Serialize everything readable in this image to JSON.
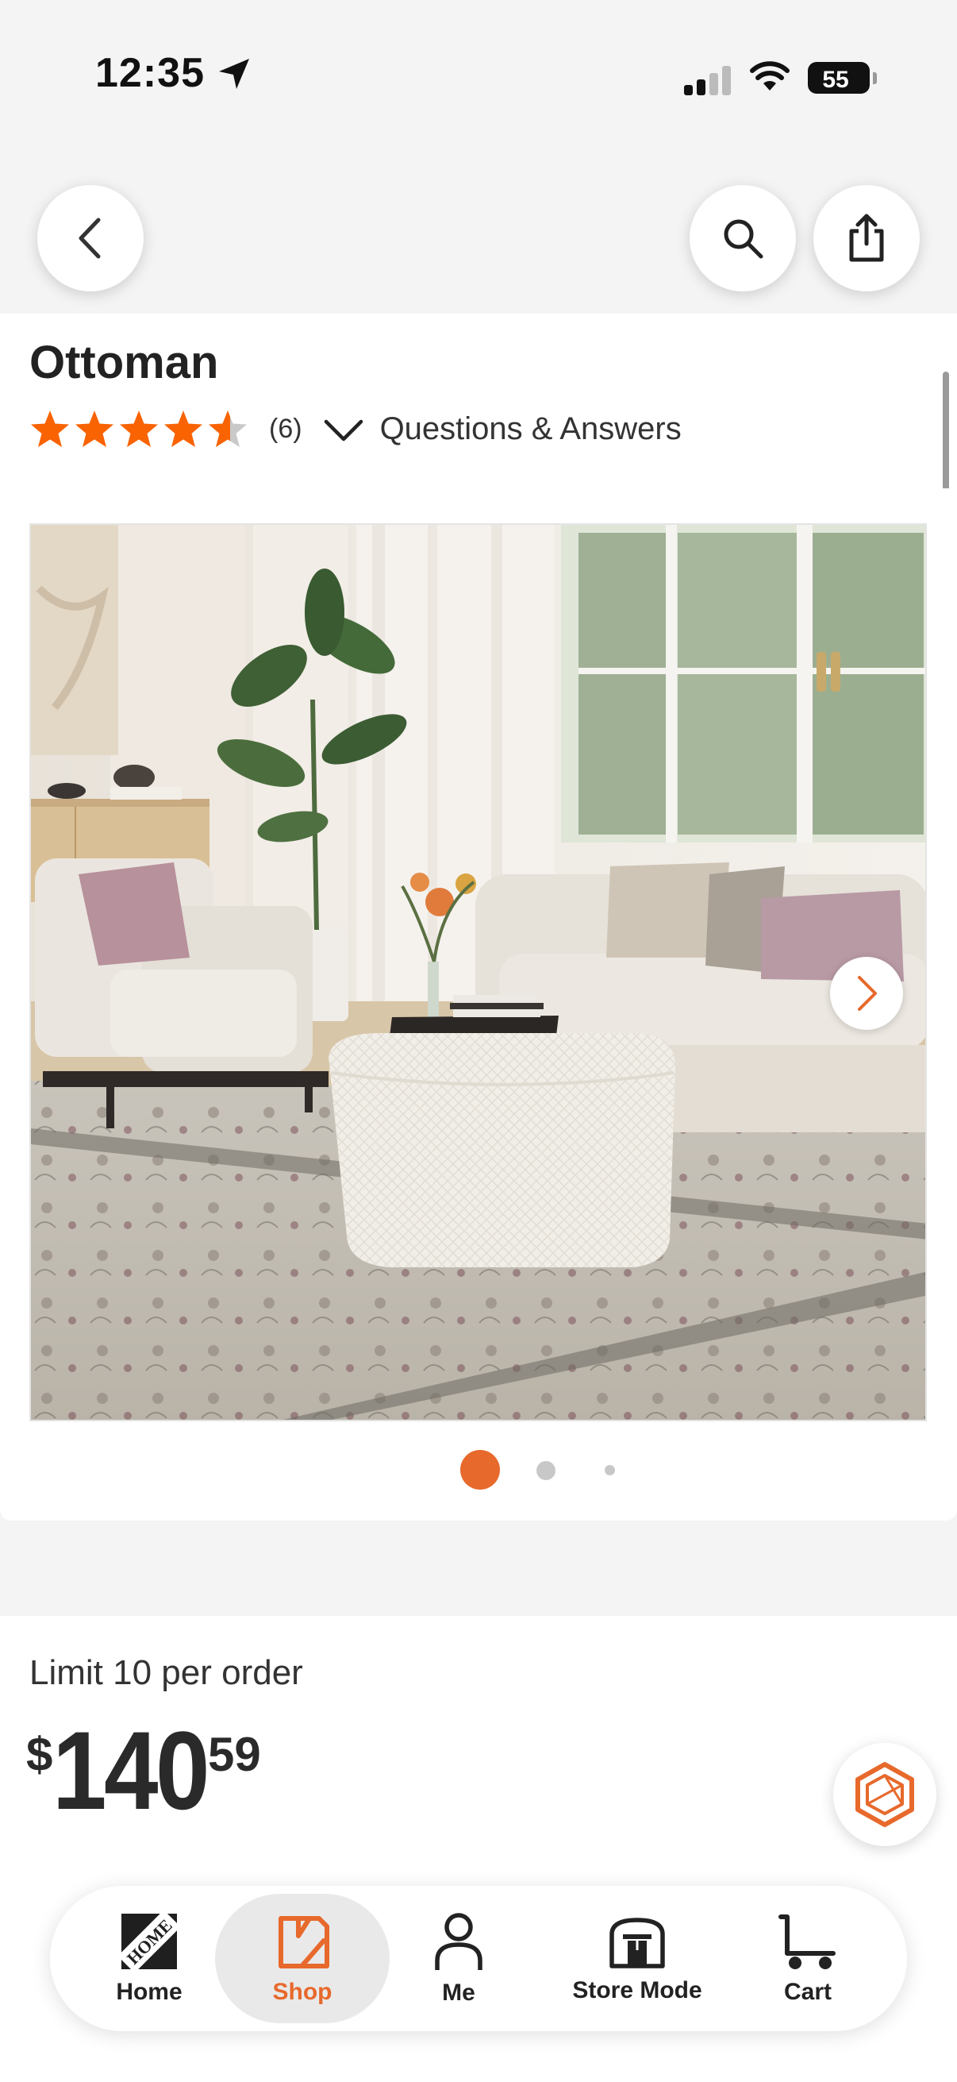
{
  "status_bar": {
    "time": "12:35",
    "battery": "55"
  },
  "header": {
    "back_icon": "chevron-left-icon",
    "search_icon": "search-icon",
    "share_icon": "share-icon"
  },
  "product": {
    "title": "Ottoman",
    "rating": 4.5,
    "review_count": "(6)",
    "qa_label": "Questions & Answers",
    "image_count": 3,
    "current_image": 1
  },
  "pricing": {
    "limit_text": "Limit 10 per order",
    "currency": "$",
    "dollars": "140",
    "cents": "59"
  },
  "colors": {
    "accent": "#e7692c",
    "star": "#f96302"
  },
  "tab_bar": {
    "items": [
      {
        "label": "Home",
        "icon": "home-depot-logo-icon"
      },
      {
        "label": "Shop",
        "icon": "shop-icon",
        "active": true
      },
      {
        "label": "Me",
        "icon": "person-icon"
      },
      {
        "label": "Store Mode",
        "icon": "store-icon"
      },
      {
        "label": "Cart",
        "icon": "cart-icon"
      }
    ]
  }
}
